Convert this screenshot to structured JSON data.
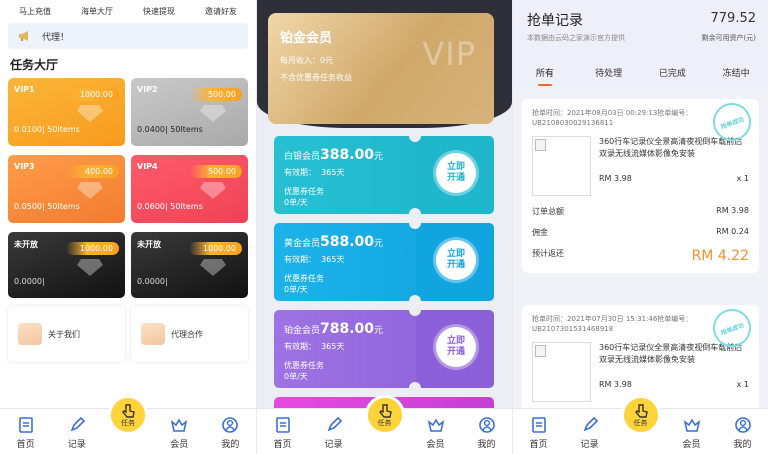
{
  "home": {
    "topnav": [
      "马上充值",
      "海单大厅",
      "快速提现",
      "邀请好友"
    ],
    "notice": "代理！",
    "section_title": "任务大厅",
    "vip_cards": [
      {
        "name": "VIP1",
        "price": "1000.00",
        "rate": "0.0100| 50Items"
      },
      {
        "name": "VIP2",
        "price": "500.00",
        "rate": "0.0400| 50Items"
      },
      {
        "name": "VIP3",
        "price": "400.00",
        "rate": "0.0500| 50Items"
      },
      {
        "name": "VIP4",
        "price": "500.00",
        "rate": "0.0600| 50Items"
      },
      {
        "name": "未开放",
        "price": "1000.00",
        "rate": "0.0000|"
      },
      {
        "name": "未开放",
        "price": "1000.00",
        "rate": "0.0000|"
      }
    ],
    "info_items": [
      "关于我们",
      "代理合作"
    ]
  },
  "membership": {
    "card_title": "铂金会员",
    "card_income": "每月收入：0元",
    "card_note": "不含优惠券任务收益",
    "card_watermark": "VIP",
    "plans": [
      {
        "name": "白银会员",
        "price": "388.00",
        "unit": "元",
        "validity": "有效期：",
        "days": "365天",
        "coupon": "优惠券任务",
        "per_day": "0单/天",
        "button": "立即\n开通"
      },
      {
        "name": "黄金会员",
        "price": "588.00",
        "unit": "元",
        "validity": "有效期：",
        "days": "365天",
        "coupon": "优惠券任务",
        "per_day": "0单/天",
        "button": "立即\n开通"
      },
      {
        "name": "铂金会员",
        "price": "788.00",
        "unit": "元",
        "validity": "有效期：",
        "days": "365天",
        "coupon": "优惠券任务",
        "per_day": "0单/天",
        "button": "立即\n开通"
      }
    ]
  },
  "records": {
    "title": "抢单记录",
    "subtitle": "本数据由云码之家演示官方提供",
    "balance": "779.52",
    "balance_label": "剩余可用资产(元)",
    "tabs": [
      "所有",
      "待处理",
      "已完成",
      "冻结中"
    ],
    "stamp": "抢单成功",
    "orders": [
      {
        "time_line": "抢单时间：2021年08月03日 00:29:13抢单编号：UB2108030029136811",
        "product": "360行车记录仪全景高清夜视倒车载前后双录无线流媒体影像免安装",
        "price": "RM 3.98",
        "qty": "x 1",
        "total_label": "订单总额",
        "total": "RM 3.98",
        "commission_label": "佣金",
        "commission": "RM 0.24",
        "return_label": "预计返还",
        "return": "RM 4.22"
      },
      {
        "time_line": "抢单时间：2021年07月30日 15:31:46抢单编号：UB2107301531468918",
        "product": "360行车记录仪全景高清夜视倒车载前后双录无线流媒体影像免安装",
        "price": "RM 3.98",
        "qty": "x 1"
      }
    ]
  },
  "tabbar": [
    "首页",
    "记录",
    "任务",
    "会员",
    "我的"
  ],
  "colors": {
    "accent_orange": "#f8922a",
    "task_yellow": "#ffd33a"
  }
}
